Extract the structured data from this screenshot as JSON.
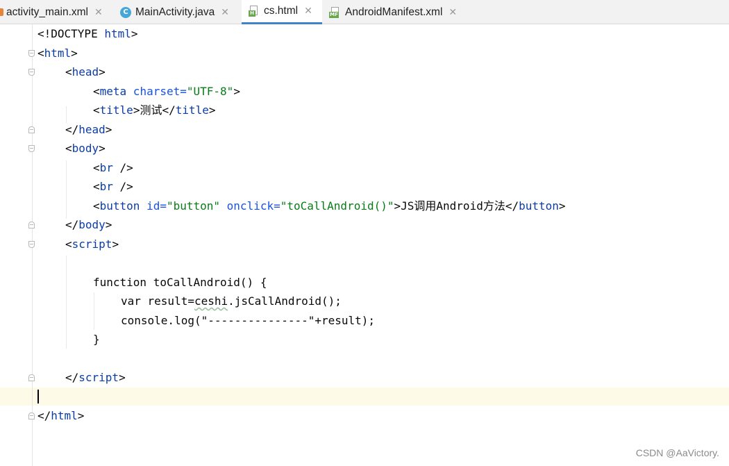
{
  "tabs": [
    {
      "label": "activity_main.xml",
      "icon": "xml-file-icon",
      "active": false
    },
    {
      "label": "MainActivity.java",
      "icon": "java-class-icon",
      "active": false
    },
    {
      "label": "cs.html",
      "icon": "html-file-icon",
      "active": true
    },
    {
      "label": "AndroidManifest.xml",
      "icon": "manifest-file-icon",
      "active": false
    }
  ],
  "tab_close_glyph": "✕",
  "code": {
    "l1_doctype": "<!DOCTYPE",
    "l1_html": " html",
    "l1_end": ">",
    "l2_open": "<",
    "l2_tag": "html",
    "l2_close": ">",
    "l3_open": "<",
    "l3_tag": "head",
    "l3_close": ">",
    "l4_open": "<",
    "l4_tag": "meta",
    "l4_attr": " charset=",
    "l4_val": "\"UTF-8\"",
    "l4_close": ">",
    "l5_open": "<",
    "l5_tag": "title",
    "l5_mid": ">测试</",
    "l5_tag2": "title",
    "l5_close": ">",
    "l6_open": "</",
    "l6_tag": "head",
    "l6_close": ">",
    "l7_open": "<",
    "l7_tag": "body",
    "l7_close": ">",
    "l8_open": "<",
    "l8_tag": "br",
    "l8_close": " />",
    "l9_open": "<",
    "l9_tag": "br",
    "l9_close": " />",
    "l10_open": "<",
    "l10_tag": "button",
    "l10_attr1": " id=",
    "l10_val1": "\"button\"",
    "l10_attr2": " onclick=",
    "l10_val2": "\"toCallAndroid()\"",
    "l10_text": ">JS调用Android方法</",
    "l10_tag2": "button",
    "l10_close": ">",
    "l11_open": "</",
    "l11_tag": "body",
    "l11_close": ">",
    "l12_open": "<",
    "l12_tag": "script",
    "l12_close": ">",
    "l14": "function toCallAndroid() {",
    "l15_pre": "var result=",
    "l15_ceshi": "ceshi",
    "l15_post": ".jsCallAndroid();",
    "l16": "console.log(\"---------------\"+result);",
    "l17": "}",
    "l19_open": "</",
    "l19_tag": "script",
    "l19_close": ">",
    "l21_open": "</",
    "l21_tag": "html",
    "l21_close": ">"
  },
  "watermark": "CSDN @AaVictory."
}
